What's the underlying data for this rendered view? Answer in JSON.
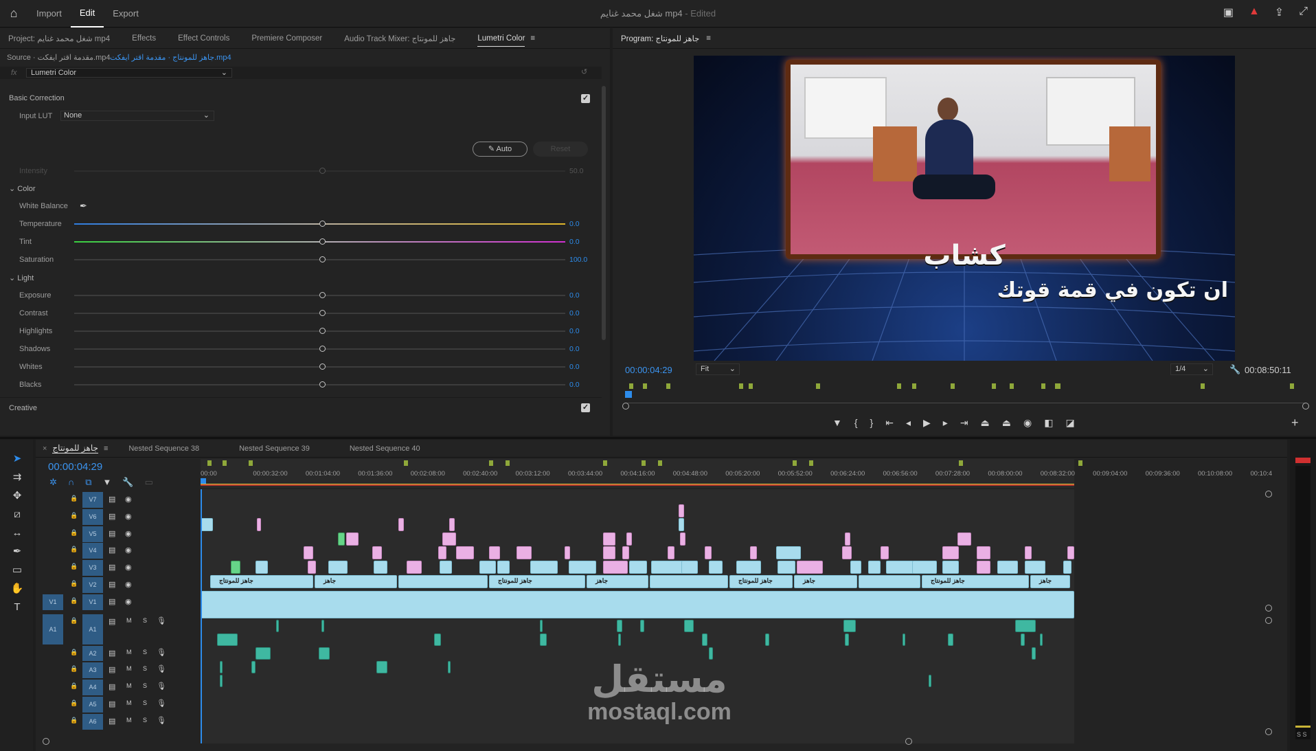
{
  "topbar": {
    "menu": [
      "Import",
      "Edit",
      "Export"
    ],
    "active_menu": "Edit",
    "title": "شغل محمد غنايم mp4",
    "edited": "- Edited"
  },
  "left_tabs": [
    "Project: شغل محمد غنايم mp4",
    "Effects",
    "Effect Controls",
    "Premiere Composer",
    "Audio Track Mixer: جاهز للمونتاج",
    "Lumetri Color"
  ],
  "source": {
    "label": "Source · مقدمة اقتر ايفكت.mp4",
    "link": "جاهز للمونتاج · مقدمة اقتر ايفكت.mp4",
    "fx": "fx",
    "effect": "Lumetri Color"
  },
  "lumetri": {
    "basic_correction": "Basic Correction",
    "input_lut_label": "Input LUT",
    "input_lut_value": "None",
    "auto_label": "Auto",
    "reset_label": "Reset",
    "intensity_label": "Intensity",
    "intensity_value": "50.0",
    "color_section": "Color",
    "white_balance": "White Balance",
    "light_section": "Light",
    "creative": "Creative",
    "sliders_color": [
      {
        "label": "Temperature",
        "value": "0.0"
      },
      {
        "label": "Tint",
        "value": "0.0"
      },
      {
        "label": "Saturation",
        "value": "100.0"
      }
    ],
    "sliders_light": [
      {
        "label": "Exposure",
        "value": "0.0"
      },
      {
        "label": "Contrast",
        "value": "0.0"
      },
      {
        "label": "Highlights",
        "value": "0.0"
      },
      {
        "label": "Shadows",
        "value": "0.0"
      },
      {
        "label": "Whites",
        "value": "0.0"
      },
      {
        "label": "Blacks",
        "value": "0.0"
      }
    ]
  },
  "program": {
    "tab": "Program: جاهز للمونتاج",
    "timecode": "00:00:04:29",
    "fit": "Fit",
    "resolution": "1/4",
    "duration": "00:08:50:11",
    "caption_line1": "كشاب",
    "caption_line2": "ان تكون في قمة قوتك"
  },
  "timeline": {
    "tabs": [
      "جاهز للمونتاج",
      "Nested Sequence 38",
      "Nested Sequence 39",
      "Nested Sequence 40"
    ],
    "timecode": "00:00:04:29",
    "ruler": [
      "00:00",
      "00:00:32:00",
      "00:01:04:00",
      "00:01:36:00",
      "00:02:08:00",
      "00:02:40:00",
      "00:03:12:00",
      "00:03:44:00",
      "00:04:16:00",
      "00:04:48:00",
      "00:05:20:00",
      "00:05:52:00",
      "00:06:24:00",
      "00:06:56:00",
      "00:07:28:00",
      "00:08:00:00",
      "00:08:32:00",
      "00:09:04:00",
      "00:09:36:00",
      "00:10:08:00",
      "00:10:4"
    ],
    "video_tracks": [
      "V7",
      "V6",
      "V5",
      "V4",
      "V3",
      "V2",
      "V1"
    ],
    "audio_tracks": [
      "A1",
      "A2",
      "A3",
      "A4",
      "A5",
      "A6"
    ],
    "source_v": "V1",
    "source_a": "A1",
    "clip_label": "جاهز للمونتاج",
    "clip_label_short": "جاهز",
    "meter_label": "S S"
  },
  "watermark": {
    "arabic": "مستقل",
    "latin": "mostaql.com"
  },
  "colors": {
    "accent": "#2d8ceb",
    "panel": "#232323",
    "video_clip": "#a8dced",
    "pink_clip": "#eab0e4",
    "green_clip": "#66d488",
    "audio_clip": "#3fb8a1"
  }
}
